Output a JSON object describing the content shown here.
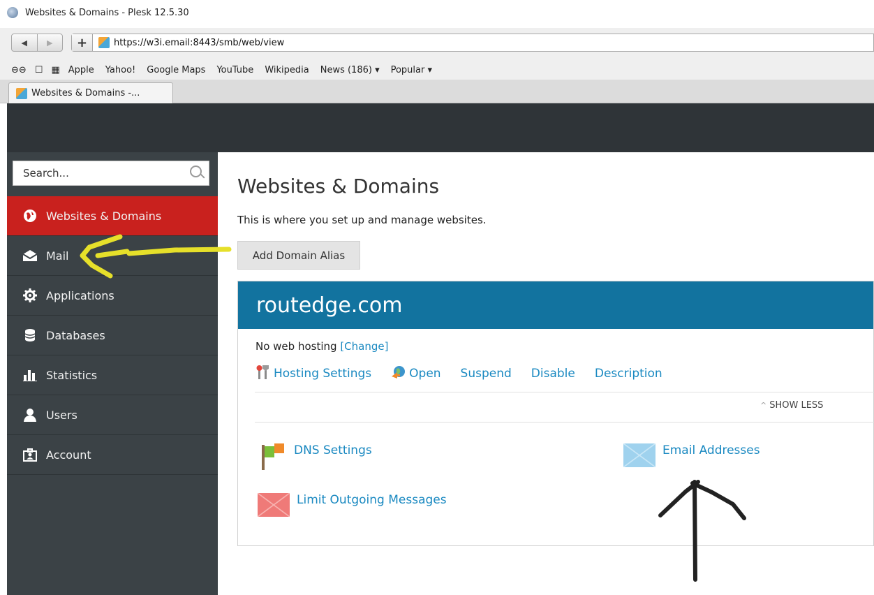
{
  "window": {
    "title": "Websites & Domains - Plesk 12.5.30"
  },
  "browser": {
    "url": "https://w3i.email:8443/smb/web/view",
    "bookmarks": [
      "Apple",
      "Yahoo!",
      "Google Maps",
      "YouTube",
      "Wikipedia",
      "News (186) ▾",
      "Popular ▾"
    ],
    "tab_title": "Websites & Domains -..."
  },
  "sidebar": {
    "search_placeholder": "Search...",
    "items": [
      {
        "label": "Websites & Domains",
        "icon": "globe-icon",
        "active": true
      },
      {
        "label": "Mail",
        "icon": "mail-icon"
      },
      {
        "label": "Applications",
        "icon": "gear-icon"
      },
      {
        "label": "Databases",
        "icon": "database-icon"
      },
      {
        "label": "Statistics",
        "icon": "bar-chart-icon"
      },
      {
        "label": "Users",
        "icon": "user-icon"
      },
      {
        "label": "Account",
        "icon": "account-icon"
      }
    ]
  },
  "main": {
    "title": "Websites & Domains",
    "description": "This is where you set up and manage websites.",
    "add_alias_label": "Add Domain Alias",
    "domain": {
      "name": "routedge.com",
      "hosting_text": "No web hosting",
      "change_link": "[Change]",
      "actions": [
        "Hosting Settings",
        "Open",
        "Suspend",
        "Disable",
        "Description"
      ],
      "show_less": "SHOW LESS",
      "tools": {
        "dns": "DNS Settings",
        "email": "Email Addresses",
        "limit": "Limit Outgoing Messages"
      }
    }
  },
  "colors": {
    "active_menu": "#c9211e",
    "sidebar_bg": "#3b4246",
    "domain_header": "#12739f",
    "link": "#1a89c1",
    "highlight_arrow": "#e6e02a",
    "black_arrow": "#222222"
  }
}
